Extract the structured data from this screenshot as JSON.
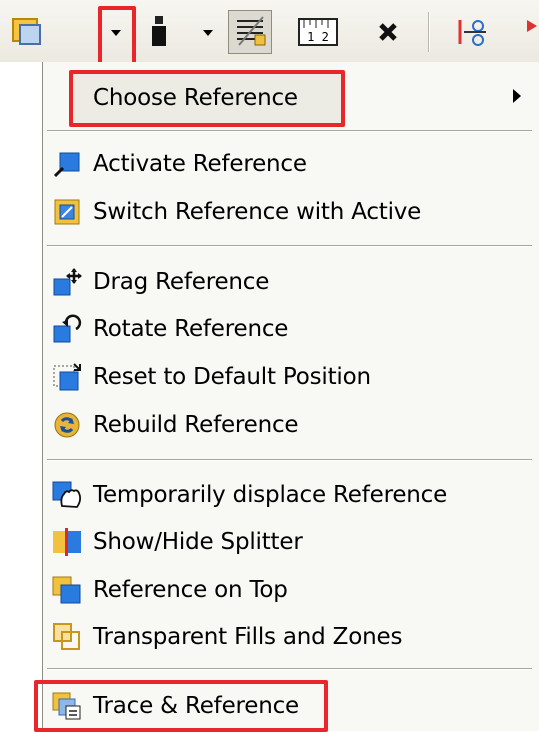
{
  "menu": {
    "choose_reference": "Choose Reference",
    "activate_reference": "Activate Reference",
    "switch_reference": "Switch Reference with Active",
    "drag_reference": "Drag Reference",
    "rotate_reference": "Rotate Reference",
    "reset_position": "Reset to Default Position",
    "rebuild_reference": "Rebuild Reference",
    "temporarily_displace": "Temporarily displace Reference",
    "show_hide_splitter": "Show/Hide Splitter",
    "reference_on_top": "Reference on Top",
    "transparent_fills": "Transparent Fills and Zones",
    "trace_reference": "Trace & Reference"
  },
  "toolbar": {
    "ruler_text": "1 2"
  },
  "colors": {
    "highlight": "#e8262b",
    "menu_bg": "#f8f8f4",
    "separator": "#a8a79f"
  }
}
